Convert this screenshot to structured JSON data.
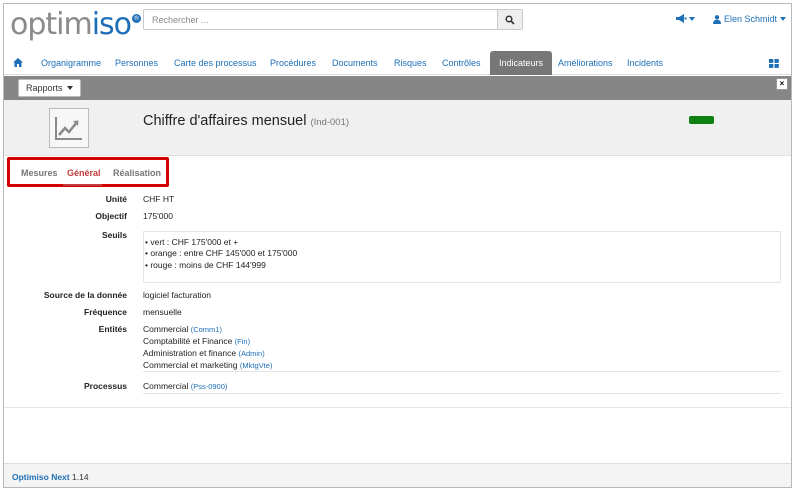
{
  "header": {
    "logo_part1": "optim",
    "logo_part2": "iso",
    "logo_badge": "®",
    "search_placeholder": "Rechercher ...",
    "user_name": "Elen Schmidt"
  },
  "nav": {
    "items": [
      {
        "label": "Organigramme"
      },
      {
        "label": "Personnes"
      },
      {
        "label": "Carte des processus"
      },
      {
        "label": "Procédures"
      },
      {
        "label": "Documents"
      },
      {
        "label": "Risques"
      },
      {
        "label": "Contrôles"
      },
      {
        "label": "Indicateurs"
      },
      {
        "label": "Améliorations"
      },
      {
        "label": "Incidents"
      }
    ],
    "active": "Indicateurs"
  },
  "toolbar": {
    "rapports_label": "Rapports",
    "close_label": "×"
  },
  "indicator": {
    "title": "Chiffre d'affaires mensuel",
    "code": "(Ind-001)",
    "status_color": "#0f7f12"
  },
  "tabs": [
    {
      "label": "Mesures"
    },
    {
      "label": "Général"
    },
    {
      "label": "Réalisation"
    }
  ],
  "active_tab": "Général",
  "details": {
    "unite_label": "Unité",
    "unite_value": "CHF HT",
    "objectif_label": "Objectif",
    "objectif_value": "175'000",
    "seuils_label": "Seuils",
    "seuils": [
      "• vert : CHF 175'000 et +",
      "• orange : entre CHF 145'000 et 175'000",
      "• rouge : moins de CHF 144'999"
    ],
    "source_label": "Source de la donnée",
    "source_value": "logiciel facturation",
    "frequence_label": "Fréquence",
    "frequence_value": "mensuelle",
    "entites_label": "Entités",
    "entites": [
      {
        "name": "Commercial",
        "code": "(Comm1)"
      },
      {
        "name": "Comptabilité et Finance",
        "code": "(Fin)"
      },
      {
        "name": "Administration et finance",
        "code": "(Admin)"
      },
      {
        "name": "Commercial et marketing",
        "code": "(MktgVte)"
      }
    ],
    "processus_label": "Processus",
    "processus": {
      "name": "Commercial",
      "code": "(Pss-0900)"
    }
  },
  "footer": {
    "brand": "Optimiso Next",
    "version": "1.14"
  },
  "colors": {
    "brand_blue": "#1d6fb8",
    "active_tab": "#c43c3c",
    "highlight_border": "#d40000",
    "toolbar_gray": "#868686"
  }
}
